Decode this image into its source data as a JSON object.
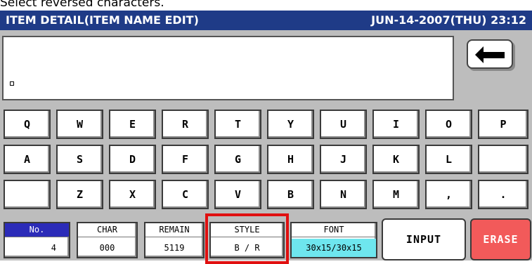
{
  "caption": "Select reversed characters.",
  "header": {
    "title": "ITEM DETAIL(ITEM NAME EDIT)",
    "datetime": "JUN-14-2007(THU) 23:12"
  },
  "keyboard": {
    "row1": [
      "Q",
      "W",
      "E",
      "R",
      "T",
      "Y",
      "U",
      "I",
      "O",
      "P"
    ],
    "row2": [
      "A",
      "S",
      "D",
      "F",
      "G",
      "H",
      "J",
      "K",
      "L",
      ""
    ],
    "row3": [
      "",
      "Z",
      "X",
      "C",
      "V",
      "B",
      "N",
      "M",
      ",",
      "."
    ]
  },
  "status": {
    "no": {
      "label": "No.",
      "value": "4"
    },
    "char": {
      "label": "CHAR",
      "value": "000"
    },
    "remain": {
      "label": "REMAIN",
      "value": "5119"
    },
    "style": {
      "label": "STYLE",
      "value": "B / R"
    },
    "font": {
      "label": "FONT",
      "value": "30x15/30x15"
    }
  },
  "actions": {
    "input": "INPUT",
    "erase": "ERASE"
  },
  "icons": {
    "back": "back-arrow-icon"
  },
  "colors": {
    "title_bg": "#1f3b87",
    "no_label_bg": "#2b2bb8",
    "font_value_bg": "#6ee6ee",
    "erase_bg": "#f25a5a",
    "highlight": "#e01010"
  }
}
